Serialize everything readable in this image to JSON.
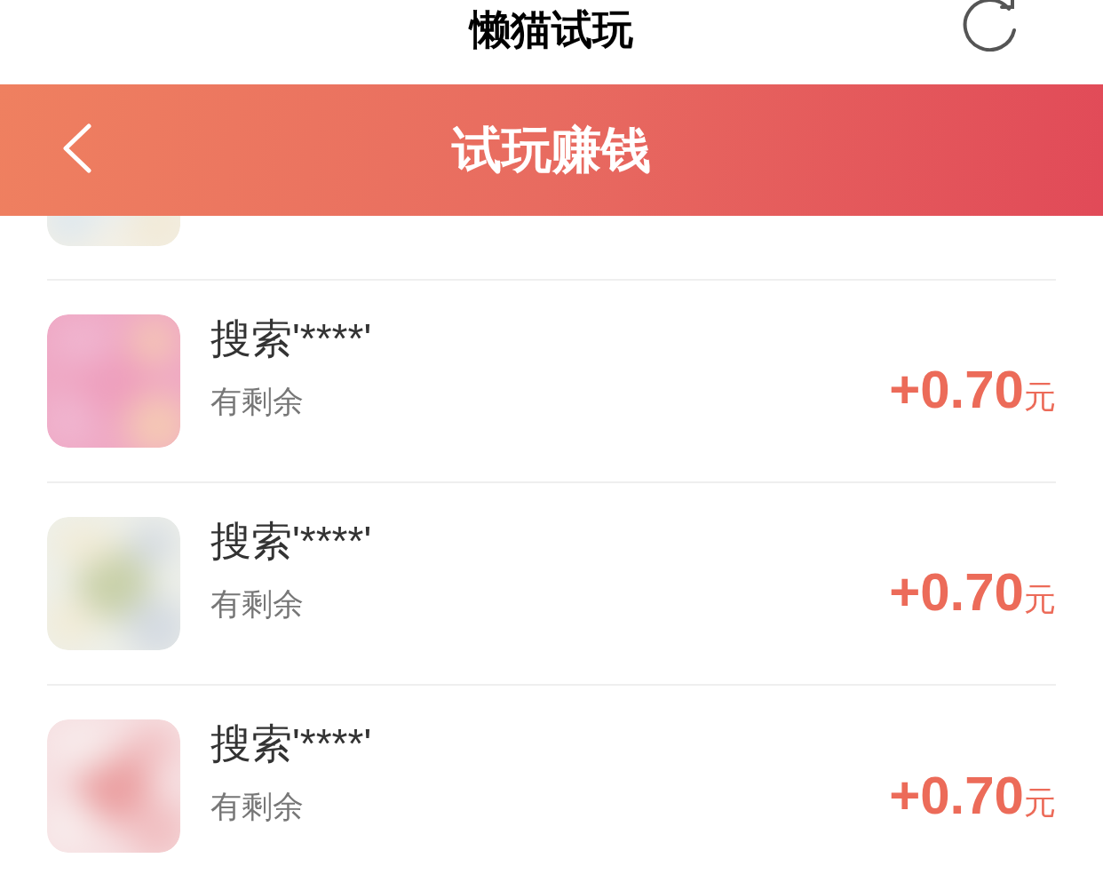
{
  "header": {
    "title": "懒猫试玩"
  },
  "nav": {
    "title": "试玩赚钱"
  },
  "tasks": [
    {
      "kind": "cut"
    },
    {
      "kind": "task",
      "title": "搜索'****'",
      "status": "有剩余",
      "amount": "+0.70",
      "unit": "元"
    },
    {
      "kind": "task",
      "title": "搜索'****'",
      "status": "有剩余",
      "amount": "+0.70",
      "unit": "元"
    },
    {
      "kind": "task",
      "title": "搜索'****'",
      "status": "有剩余",
      "amount": "+0.70",
      "unit": "元"
    }
  ]
}
